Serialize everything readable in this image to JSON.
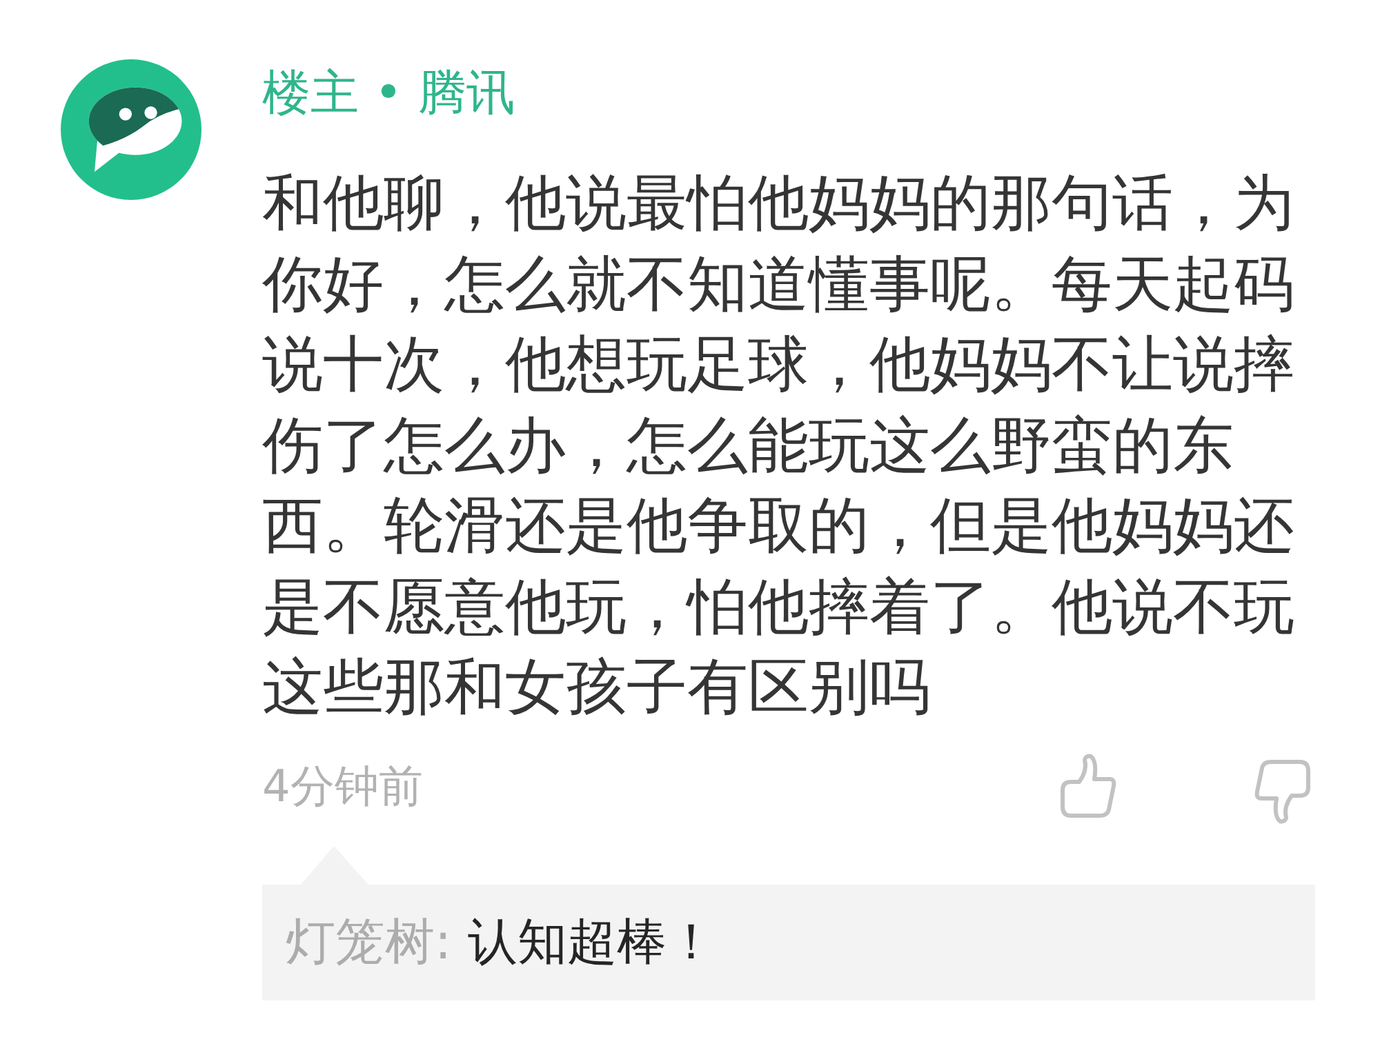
{
  "post": {
    "author": "楼主 • 腾讯",
    "body": "和他聊，他说最怕他妈妈的那句话，为你好，怎么就不知道懂事呢。每天起码说十次，他想玩足球，他妈妈不让说摔伤了怎么办，怎么能玩这么野蛮的东西。轮滑还是他争取的，但是他妈妈还是不愿意他玩，怕他摔着了。他说不玩这些那和女孩子有区别吗",
    "time": "4分钟前"
  },
  "replies": [
    {
      "author": "灯笼树:",
      "text": "认知超棒！"
    }
  ]
}
